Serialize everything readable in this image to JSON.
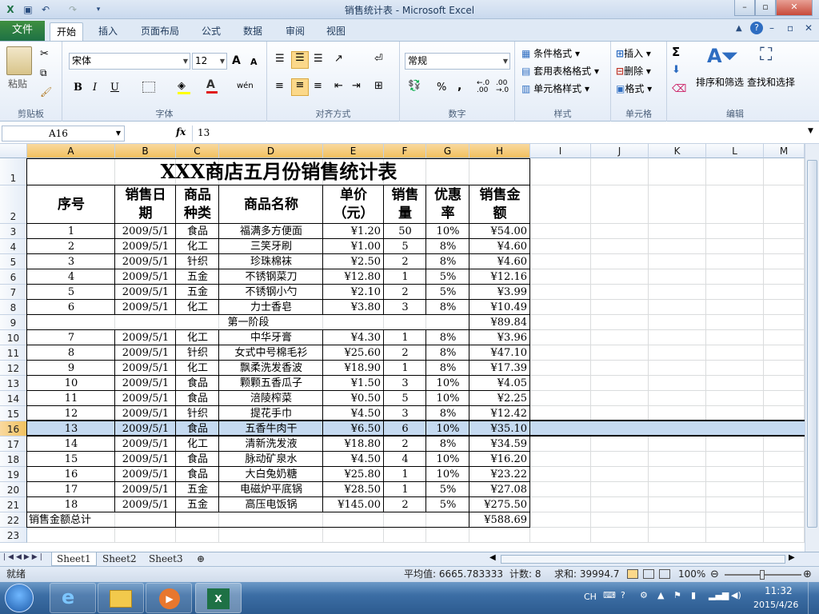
{
  "window": {
    "title": "销售统计表 - Microsoft Excel"
  },
  "quick_access": {
    "icons": [
      "excel-icon",
      "save-icon",
      "undo-icon",
      "redo-icon",
      "customize-icon"
    ]
  },
  "tabs": [
    {
      "label": "文件"
    },
    {
      "label": "开始"
    },
    {
      "label": "插入"
    },
    {
      "label": "页面布局"
    },
    {
      "label": "公式"
    },
    {
      "label": "数据"
    },
    {
      "label": "审阅"
    },
    {
      "label": "视图"
    }
  ],
  "ribbon": {
    "clipboard": {
      "label": "剪贴板",
      "paste": "粘贴"
    },
    "font": {
      "label": "字体",
      "name": "宋体",
      "size": "12",
      "grow": "A",
      "shrink": "A",
      "bold": "B",
      "italic": "I",
      "underline": "U",
      "phonetic": "wén"
    },
    "alignment": {
      "label": "对齐方式"
    },
    "number": {
      "label": "数字",
      "format": "常规",
      "percent": "%",
      "comma": ",",
      "inc_dec": ".0\n.00",
      "dec_dec": ".00\n→.0"
    },
    "styles": {
      "label": "样式",
      "conditional": "条件格式",
      "table": "套用表格格式",
      "cell_styles": "单元格样式"
    },
    "cells": {
      "label": "单元格",
      "insert": "插入",
      "delete": "删除",
      "format": "格式"
    },
    "editing": {
      "label": "编辑",
      "sigma": "Σ",
      "sort_filter": "排序和筛选",
      "find_select": "查找和选择"
    }
  },
  "formula_bar": {
    "name_box": "A16",
    "fx": "fx",
    "value": "13"
  },
  "columns": [
    "A",
    "B",
    "C",
    "D",
    "E",
    "F",
    "G",
    "H",
    "I",
    "J",
    "K",
    "L",
    "M"
  ],
  "rows": [
    "1",
    "2",
    "3",
    "4",
    "5",
    "6",
    "7",
    "8",
    "9",
    "10",
    "11",
    "12",
    "13",
    "14",
    "15",
    "16",
    "17",
    "18",
    "19",
    "20",
    "21",
    "22",
    "23"
  ],
  "sheet": {
    "title": "XXX商店五月份销售统计表",
    "headers": {
      "seq": "序号",
      "date": [
        "销售日",
        "期"
      ],
      "type": [
        "商品",
        "种类"
      ],
      "name": "商品名称",
      "price": [
        "单价",
        "（元）"
      ],
      "qty": [
        "销售",
        "量"
      ],
      "disc": [
        "优惠",
        "率"
      ],
      "amount": [
        "销售金",
        "额"
      ]
    },
    "data_rows": [
      {
        "seq": "1",
        "date": "2009/5/1",
        "type": "食品",
        "name": "福满多方便面",
        "price": "¥1.20",
        "qty": "50",
        "disc": "10%",
        "amount": "¥54.00"
      },
      {
        "seq": "2",
        "date": "2009/5/1",
        "type": "化工",
        "name": "三笑牙刷",
        "price": "¥1.00",
        "qty": "5",
        "disc": "8%",
        "amount": "¥4.60"
      },
      {
        "seq": "3",
        "date": "2009/5/1",
        "type": "针织",
        "name": "珍珠棉袜",
        "price": "¥2.50",
        "qty": "2",
        "disc": "8%",
        "amount": "¥4.60"
      },
      {
        "seq": "4",
        "date": "2009/5/1",
        "type": "五金",
        "name": "不锈钢菜刀",
        "price": "¥12.80",
        "qty": "1",
        "disc": "5%",
        "amount": "¥12.16"
      },
      {
        "seq": "5",
        "date": "2009/5/1",
        "type": "五金",
        "name": "不锈钢小勺",
        "price": "¥2.10",
        "qty": "2",
        "disc": "5%",
        "amount": "¥3.99"
      },
      {
        "seq": "6",
        "date": "2009/5/1",
        "type": "化工",
        "name": "力士香皂",
        "price": "¥3.80",
        "qty": "3",
        "disc": "8%",
        "amount": "¥10.49"
      },
      {
        "phase": "第一阶段",
        "amount": "¥89.84"
      },
      {
        "seq": "7",
        "date": "2009/5/1",
        "type": "化工",
        "name": "中华牙膏",
        "price": "¥4.30",
        "qty": "1",
        "disc": "8%",
        "amount": "¥3.96"
      },
      {
        "seq": "8",
        "date": "2009/5/1",
        "type": "针织",
        "name": "女式中号棉毛衫",
        "price": "¥25.60",
        "qty": "2",
        "disc": "8%",
        "amount": "¥47.10"
      },
      {
        "seq": "9",
        "date": "2009/5/1",
        "type": "化工",
        "name": "飘柔洗发香波",
        "price": "¥18.90",
        "qty": "1",
        "disc": "8%",
        "amount": "¥17.39"
      },
      {
        "seq": "10",
        "date": "2009/5/1",
        "type": "食品",
        "name": "颗颗五香瓜子",
        "price": "¥1.50",
        "qty": "3",
        "disc": "10%",
        "amount": "¥4.05"
      },
      {
        "seq": "11",
        "date": "2009/5/1",
        "type": "食品",
        "name": "涪陵榨菜",
        "price": "¥0.50",
        "qty": "5",
        "disc": "10%",
        "amount": "¥2.25"
      },
      {
        "seq": "12",
        "date": "2009/5/1",
        "type": "针织",
        "name": "提花手巾",
        "price": "¥4.50",
        "qty": "3",
        "disc": "8%",
        "amount": "¥12.42"
      },
      {
        "seq": "13",
        "date": "2009/5/1",
        "type": "食品",
        "name": "五香牛肉干",
        "price": "¥6.50",
        "qty": "6",
        "disc": "10%",
        "amount": "¥35.10"
      },
      {
        "seq": "14",
        "date": "2009/5/1",
        "type": "化工",
        "name": "清新洗发液",
        "price": "¥18.80",
        "qty": "2",
        "disc": "8%",
        "amount": "¥34.59"
      },
      {
        "seq": "15",
        "date": "2009/5/1",
        "type": "食品",
        "name": "脉动矿泉水",
        "price": "¥4.50",
        "qty": "4",
        "disc": "10%",
        "amount": "¥16.20"
      },
      {
        "seq": "16",
        "date": "2009/5/1",
        "type": "食品",
        "name": "大白兔奶糖",
        "price": "¥25.80",
        "qty": "1",
        "disc": "10%",
        "amount": "¥23.22"
      },
      {
        "seq": "17",
        "date": "2009/5/1",
        "type": "五金",
        "name": "电磁炉平底锅",
        "price": "¥28.50",
        "qty": "1",
        "disc": "5%",
        "amount": "¥27.08"
      },
      {
        "seq": "18",
        "date": "2009/5/1",
        "type": "五金",
        "name": "高压电饭锅",
        "price": "¥145.00",
        "qty": "2",
        "disc": "5%",
        "amount": "¥275.50"
      }
    ],
    "total_label": "销售金额总计",
    "total_value": "¥588.69"
  },
  "sheet_tabs": [
    "Sheet1",
    "Sheet2",
    "Sheet3"
  ],
  "status": {
    "mode": "就绪",
    "average": "平均值: 6665.783333",
    "count": "计数: 8",
    "sum": "求和: 39994.7",
    "zoom": "100%"
  },
  "taskbar": {
    "ime": "CH",
    "time": "11:32",
    "date": "2015/4/26"
  },
  "colors": {
    "selection": "#c5daf1",
    "file_tab": "#1e7145",
    "header_highlight": "#f1c15f"
  }
}
